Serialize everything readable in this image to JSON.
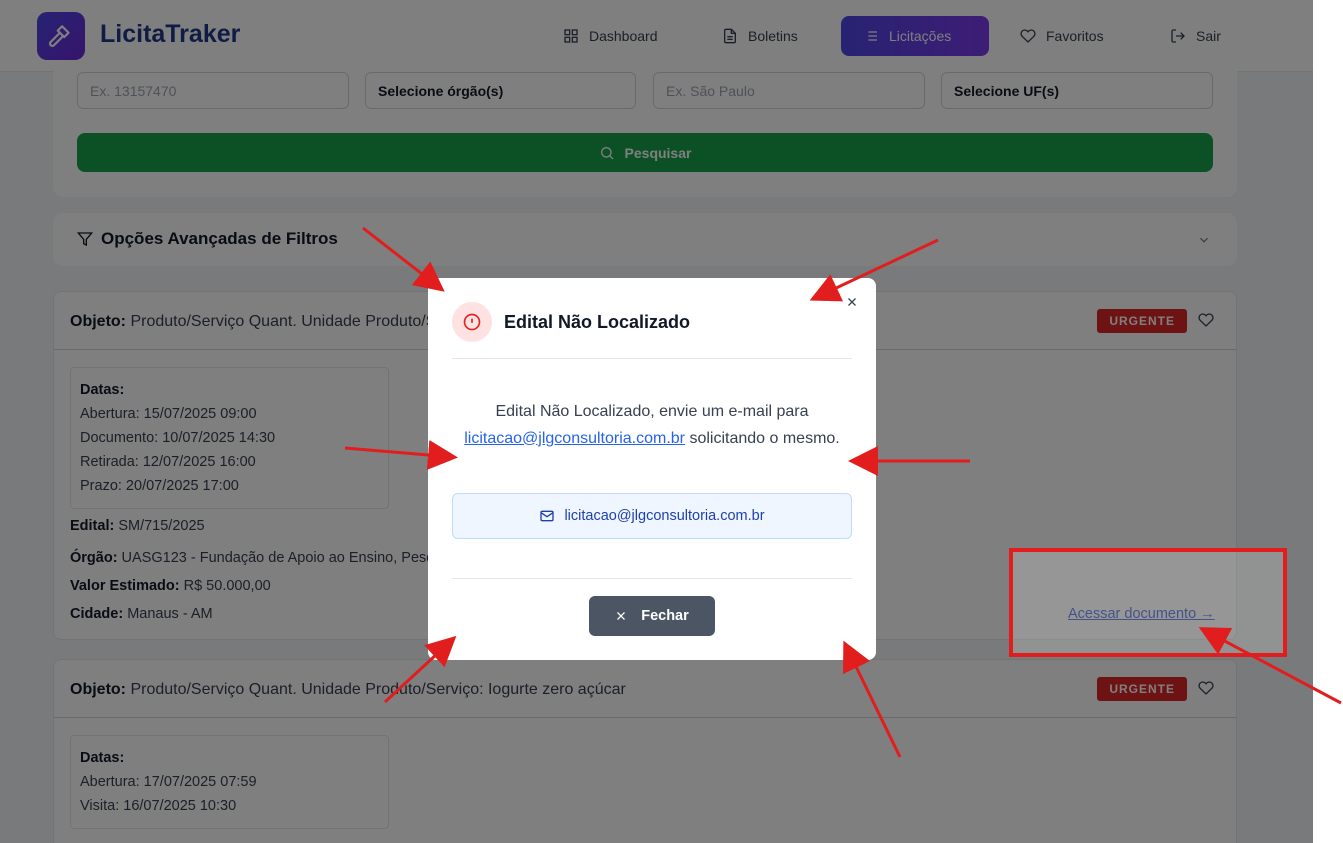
{
  "app": {
    "brand": "LicitaTraker"
  },
  "nav": [
    {
      "label": "Dashboard",
      "icon": "grid-icon"
    },
    {
      "label": "Boletins",
      "icon": "file-text-icon"
    },
    {
      "label": "Licitações",
      "icon": "list-icon",
      "active": true
    },
    {
      "label": "Favoritos",
      "icon": "heart-icon"
    },
    {
      "label": "Sair",
      "icon": "logout-icon"
    }
  ],
  "search": {
    "field1_placeholder": "Ex. 13157470",
    "field2_value": "Selecione órgão(s)",
    "field3_placeholder": "Ex. São Paulo",
    "field4_value": "Selecione UF(s)",
    "button_label": "Pesquisar"
  },
  "filters": {
    "title": "Opções Avançadas de Filtros"
  },
  "results": [
    {
      "object_label": "Objeto:",
      "object_text": " Produto/Serviço Quant. Unidade Produto/Serviço: Iogurte zero açúcar",
      "badge": "URGENTE",
      "dates_title": "Datas:",
      "dates": [
        "Abertura: 15/07/2025 09:00",
        "Documento: 10/07/2025 14:30",
        "Retirada: 12/07/2025 16:00",
        "Prazo: 20/07/2025 17:00"
      ],
      "edital_label": "Edital:",
      "edital_value": " SM/715/2025",
      "orgao_label": "Órgão:",
      "orgao_value": " UASG123 - Fundação de Apoio ao Ensino, Pesquisa",
      "valor_label": "Valor Estimado:",
      "valor_value": " R$ 50.000,00",
      "cidade_label": "Cidade:",
      "cidade_value": " Manaus - AM",
      "doc_link": "Acessar documento →"
    },
    {
      "object_label": "Objeto:",
      "object_text": " Produto/Serviço Quant. Unidade Produto/Serviço: Iogurte zero açúcar",
      "badge": "URGENTE",
      "dates_title": "Datas:",
      "dates": [
        "Abertura: 17/07/2025 07:59",
        "Visita: 16/07/2025 10:30"
      ]
    }
  ],
  "modal": {
    "title": "Edital Não Localizado",
    "message_before": "Edital Não Localizado, envie um e-mail para ",
    "email": "licitacao@jlgconsultoria.com.br",
    "message_after": " solicitando o mesmo.",
    "close_label": "Fechar"
  },
  "colors": {
    "annotation": "#e11d1d",
    "accent": "#4f46e5",
    "danger": "#dc2626"
  }
}
